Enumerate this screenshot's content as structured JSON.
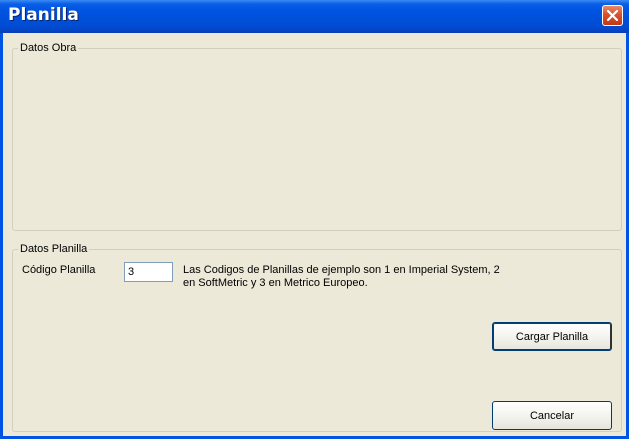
{
  "window": {
    "title": "Planilla",
    "close_icon": "close-icon"
  },
  "datos_obra": {
    "legend": "Datos Obra"
  },
  "datos_planilla": {
    "legend": "Datos Planilla",
    "codigo_label": "Código Planilla",
    "codigo_value": "3",
    "info_text": "Las Codigos de Planillas de ejemplo son 1 en Imperial System, 2 en SoftMetric y 3 en Metrico Europeo."
  },
  "buttons": {
    "cargar": "Cargar Planilla",
    "cancelar": "Cancelar"
  },
  "colors": {
    "titlebar": "#0054e3",
    "dialog_bg": "#ece9d8",
    "close_button": "#d8502c"
  }
}
